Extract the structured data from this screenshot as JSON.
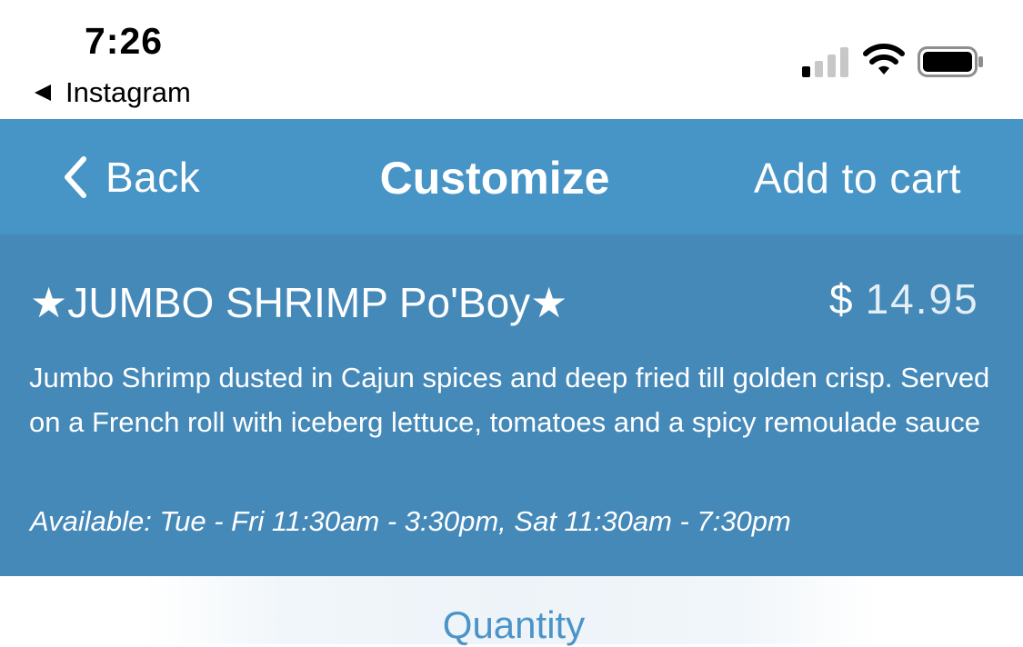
{
  "status_bar": {
    "time": "7:26",
    "back_app": "Instagram",
    "icons": [
      "back-triangle-icon",
      "cellular-signal-icon",
      "wifi-icon",
      "battery-icon"
    ]
  },
  "nav": {
    "back_label": "Back",
    "title": "Customize",
    "add_to_cart_label": "Add to cart",
    "background_color": "#4794c6",
    "icons": [
      "chevron-left-icon"
    ]
  },
  "item": {
    "title": "★JUMBO SHRIMP Po'Boy★",
    "price_currency": "$",
    "price_amount": "14.95",
    "description": "Jumbo Shrimp dusted in Cajun spices and deep fried till golden crisp. Served on a French roll with iceberg lettuce, tomatoes and a spicy remoulade sauce",
    "availability": "Available: Tue - Fri 11:30am - 3:30pm, Sat 11:30am - 7:30pm",
    "background_color": "#4589b9"
  },
  "quantity": {
    "label": "Quantity",
    "accent_color": "#4b94c7"
  }
}
